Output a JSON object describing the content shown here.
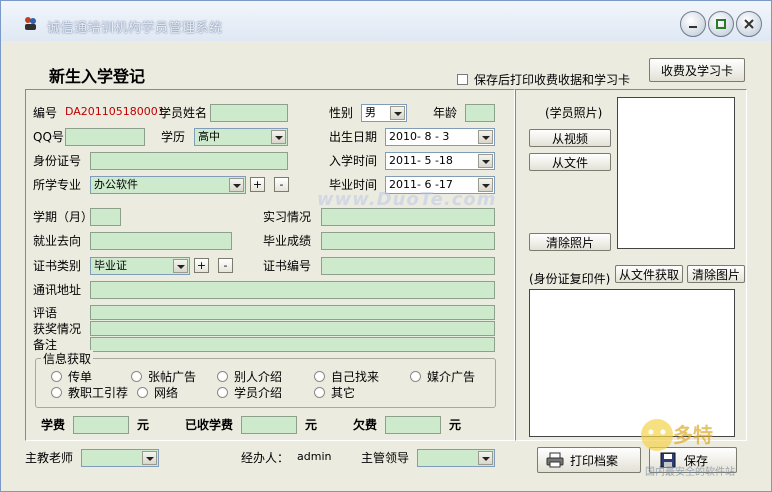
{
  "window": {
    "title": "诚信通培训机构学员管理系统"
  },
  "header": {
    "heading": "新生入学登记",
    "save_print_checkbox": "保存后打印收费收据和学习卡",
    "fee_card_button": "收费及学习卡"
  },
  "form": {
    "id_label": "编号",
    "id_value": "DA201105180001",
    "name_label": "学员姓名",
    "name_value": "",
    "gender_label": "性别",
    "gender_value": "男",
    "age_label": "年龄",
    "age_value": "",
    "qq_label": "QQ号",
    "qq_value": "",
    "edu_label": "学历",
    "edu_value": "高中",
    "birth_label": "出生日期",
    "birth_value": "2010- 8 - 3",
    "idcard_label": "身份证号",
    "idcard_value": "",
    "enroll_label": "入学时间",
    "enroll_value": "2011- 5 -18",
    "major_label": "所学专业",
    "major_value": "办公软件",
    "grad_label": "毕业时间",
    "grad_value": "2011- 6 -17",
    "plus": "+",
    "minus": "-",
    "term_label": "学期（月）",
    "internship_label": "实习情况",
    "job_label": "就业去向",
    "grades_label": "毕业成绩",
    "cert_type_label": "证书类别",
    "cert_type_value": "毕业证",
    "cert_no_label": "证书编号",
    "address_label": "通讯地址",
    "comment_label": "评语",
    "awards_label": "获奖情况",
    "remarks_label": "备注"
  },
  "info_source": {
    "legend": "信息获取",
    "options": [
      "传单",
      "张帖广告",
      "别人介绍",
      "自己找来",
      "媒介广告",
      "教职工引荐",
      "网络",
      "学员介绍",
      "其它"
    ]
  },
  "fees": {
    "tuition_label": "学费",
    "paid_label": "已收学费",
    "owed_label": "欠费",
    "unit": "元"
  },
  "photo_panel": {
    "photo_label": "(学员照片)",
    "from_video": "从视频",
    "from_file": "从文件",
    "clear_photo": "清除照片",
    "idcopy_label": "(身份证复印件)",
    "from_file_get": "从文件获取",
    "clear_image": "清除图片"
  },
  "footer": {
    "teacher_label": "主教老师",
    "handler_label": "经办人：",
    "handler_value": "admin",
    "supervisor_label": "主管领导",
    "print_button": "打印档案",
    "save_button": "保存"
  },
  "watermark": "www.DuoTe.com",
  "brand": {
    "name": "多特",
    "sub": "国内最安全的软件站"
  }
}
